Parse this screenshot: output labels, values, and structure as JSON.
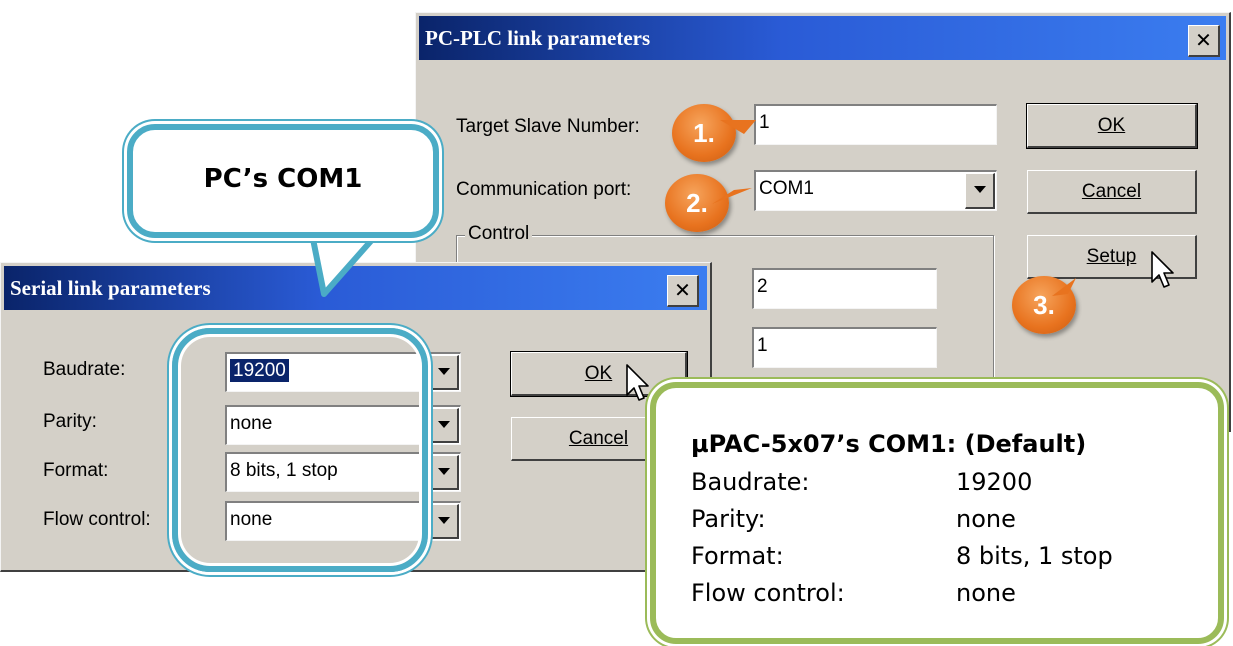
{
  "plc_dialog": {
    "title": "PC-PLC link parameters",
    "close_glyph": "✕",
    "target_slave_label": "Target Slave Number:",
    "target_slave_value": "1",
    "comm_port_label": "Communication port:",
    "comm_port_value": "COM1",
    "control_group_label": "Control",
    "control_value_1": "2",
    "control_value_2": "1",
    "ok_label": "OK",
    "cancel_label": "Cancel",
    "setup_label": "Setup"
  },
  "serial_dialog": {
    "title": "Serial link parameters",
    "close_glyph": "✕",
    "baudrate_label": "Baudrate:",
    "baudrate_value": "19200",
    "parity_label": "Parity:",
    "parity_value": "none",
    "format_label": "Format:",
    "format_value": "8 bits, 1 stop",
    "flow_label": "Flow control:",
    "flow_value": "none",
    "ok_label": "OK",
    "cancel_label": "Cancel"
  },
  "markers": {
    "step1": "1.",
    "step2": "2.",
    "step3": "3."
  },
  "callout_pc": {
    "text": "PC’s COM1"
  },
  "callout_info": {
    "heading": "µPAC-5x07’s COM1: (Default)",
    "rows": [
      {
        "label": "Baudrate:",
        "value": "19200"
      },
      {
        "label": "Parity:",
        "value": "none"
      },
      {
        "label": "Format:",
        "value": "8 bits, 1 stop"
      },
      {
        "label": "Flow control:",
        "value": "none"
      }
    ]
  },
  "colors": {
    "titlebar": "#0a246a",
    "dialog": "#d4d0c8",
    "callout_blue": "#4bacc6",
    "callout_green": "#9bbb59",
    "marker": "#e8731f"
  }
}
